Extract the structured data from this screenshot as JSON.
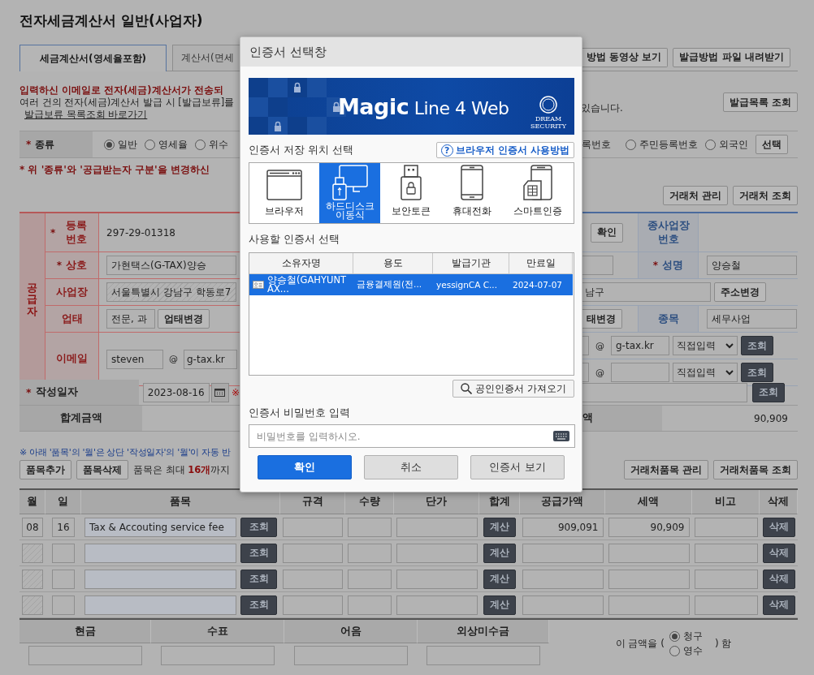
{
  "title": "전자세금계산서 일반(사업자)",
  "tabs": [
    {
      "label": "세금계산서(영세율포함)",
      "selected": true
    },
    {
      "label": "계산서(면세",
      "selected": false
    }
  ],
  "guide_buttons": [
    "방법 동영상 보기",
    "발급방법 파일 내려받기"
  ],
  "notice": {
    "warning": "입력하신 이메일로 전자(세금)계산서가 전송되",
    "info": "여러 건의 전자(세금)계산서 발급 시 [발급보류]를",
    "info_right": "있습니다.",
    "link": "발급보류 목록조회 바로가기",
    "list_button": "발급목록 조회"
  },
  "kind_row": {
    "mark": "*",
    "label": "종류",
    "options": [
      {
        "label": "일반",
        "selected": true
      },
      {
        "label": "영세율",
        "selected": false
      },
      {
        "label": "위수",
        "selected": false
      }
    ]
  },
  "receiver_kind": {
    "partial_label": "록번호",
    "options": [
      {
        "label": "주민등록번호",
        "selected": false
      },
      {
        "label": "외국인",
        "selected": false
      }
    ],
    "button": "선택"
  },
  "change_warning": "* 위 '종류'와 '공급받는자 구분'을 변경하신",
  "partner_buttons": [
    "거래처 관리",
    "거래처 조회"
  ],
  "supplier": {
    "side_label": "공급자",
    "rows": [
      {
        "kind": "text",
        "mark": "*",
        "label": "등록 번호",
        "value": "297-29-01318"
      },
      {
        "kind": "input",
        "mark": "*",
        "label": "상호",
        "value": "가현택스(G-TAX)양승",
        "readonly": false
      },
      {
        "kind": "input",
        "label": "사업장",
        "value": "서울특별시 강남구 학동로7",
        "readonly": true
      },
      {
        "kind": "input_button",
        "label": "업태",
        "value": "전문, 과",
        "button": "업태변경"
      },
      {
        "kind": "email",
        "label": "이메일",
        "user": "steven",
        "at": "@",
        "domain": "g-tax.kr"
      }
    ]
  },
  "receiver": {
    "rows": [
      {
        "kind": "button_label",
        "button": "확인",
        "label": "종사업장 번호"
      },
      {
        "kind": "input_label",
        "mark": "*",
        "label": "성명",
        "value": "양승철"
      },
      {
        "kind": "address",
        "value": "남구",
        "button": "주소변경"
      },
      {
        "kind": "button_label",
        "button": "태변경",
        "label": "종목",
        "value": "세무사업"
      },
      {
        "kind": "email",
        "at": "@",
        "domain": "g-tax.kr",
        "select": "직접입력",
        "button": "조회"
      },
      {
        "kind": "email",
        "at": "@",
        "select": "직접입력",
        "button": "조회"
      }
    ]
  },
  "date_row": {
    "mark": "*",
    "label": "작성일자",
    "value": "2023-08-16",
    "note": "※",
    "button": "조회"
  },
  "total_row": {
    "label": "합계금액",
    "right_label": "액",
    "value": "90,909"
  },
  "items_notice": "※ 아래 '품목'의 '월'은 상단 '작성일자'의 '월'이 자동 반",
  "items_toolbar": {
    "buttons": [
      "품목추가",
      "품목삭제"
    ],
    "limit_note": "품목은 최대 **16개**까지",
    "partner_buttons": [
      "거래처품목 관리",
      "거래처품목 조회"
    ]
  },
  "items": {
    "columns": [
      "월",
      "일",
      "품목",
      "규격",
      "수량",
      "단가",
      "합계",
      "공급가액",
      "세액",
      "비고",
      "삭제"
    ],
    "rows": [
      {
        "disabled": false,
        "month": "08",
        "day": "16",
        "item": "Tax & Accouting service fee",
        "lookup": "조회",
        "total": "계산",
        "supply": "909,091",
        "tax": "90,909",
        "delete": "삭제"
      },
      {
        "disabled": true,
        "lookup": "조회",
        "total": "계산",
        "delete": "삭제"
      },
      {
        "disabled": true,
        "lookup": "조회",
        "total": "계산",
        "delete": "삭제"
      },
      {
        "disabled": true,
        "lookup": "조회",
        "total": "계산",
        "delete": "삭제"
      }
    ]
  },
  "payment": {
    "columns": [
      "현금",
      "수표",
      "어음",
      "외상미수금"
    ]
  },
  "claim": {
    "prefix": "이 금액을 (",
    "options": [
      {
        "label": "청구",
        "selected": true
      },
      {
        "label": "영수",
        "selected": false
      }
    ],
    "suffix": ") 함"
  },
  "cert_dialog": {
    "title": "인증서 선택창",
    "banner": {
      "title": "**Magic** Line 4 Web",
      "maker": "DREAM SECURITY"
    },
    "storage_label": "인증서 저장 위치 선택",
    "help_button": {
      "icon": "?",
      "label": "브라우저 인증서 사용방법"
    },
    "storage": [
      {
        "kind": "browser",
        "label": "브라우저",
        "selected": false
      },
      {
        "kind": "removable",
        "label": "하드디스크 이동식",
        "selected": true
      },
      {
        "kind": "token",
        "label": "보안토큰",
        "selected": false
      },
      {
        "kind": "phone",
        "label": "휴대전화",
        "selected": false
      },
      {
        "kind": "smart",
        "label": "스마트인증",
        "selected": false
      }
    ],
    "cert_label": "사용할 인증서 선택",
    "cert_columns": [
      "소유자명",
      "용도",
      "발급기관",
      "만료일"
    ],
    "certs": [
      {
        "owner": "양승철(GAHYUNTAX...",
        "usage": "금융결제원(전...",
        "issuer": "yessignCA C...",
        "expires": "2024-07-07",
        "selected": true
      }
    ],
    "import_button": "공인인증서 가져오기",
    "password_label": "인증서 비밀번호 입력",
    "password": {
      "placeholder": "비밀번호를 입력하시오."
    },
    "buttons": [
      {
        "kind": "primary",
        "label": "확인"
      },
      {
        "kind": "normal",
        "label": "취소"
      },
      {
        "kind": "normal",
        "label": "인증서 보기"
      }
    ]
  }
}
